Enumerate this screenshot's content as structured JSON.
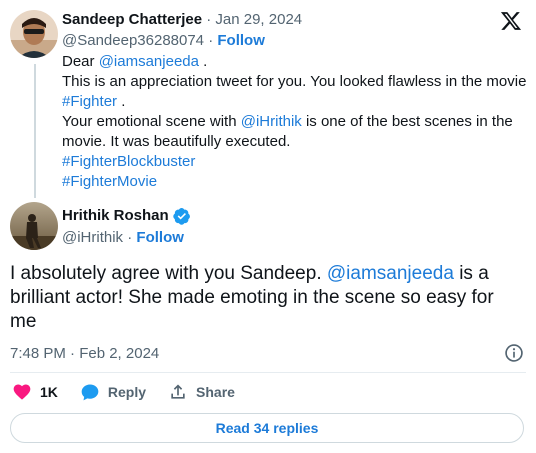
{
  "parent": {
    "name": "Sandeep Chatterjee",
    "separator": "·",
    "date": "Jan 29, 2024",
    "handle": "@Sandeep36288074",
    "follow_sep": "·",
    "follow": "Follow",
    "body": {
      "l1_a": "Dear ",
      "l1_mention": "@iamsanjeeda",
      "l1_b": " .",
      "l2": "This is an appreciation tweet for you. You looked flawless in the movie",
      "l3_tag": "#Fighter",
      "l3_b": " .",
      "l4_a": "Your emotional scene with ",
      "l4_mention": "@iHrithik",
      "l4_b": " is one of the best scenes in the",
      "l5": "movie. It was beautifully executed.",
      "l6_tag": "#FighterBlockbuster",
      "l7_tag": "#FighterMovie"
    }
  },
  "reply": {
    "name": "Hrithik Roshan",
    "verified_icon": "verified-badge-icon",
    "handle": "@iHrithik",
    "follow_sep": "·",
    "follow": "Follow",
    "text_a": "I absolutely agree with you Sandeep. ",
    "text_mention": "@iamsanjeeda",
    "text_b": " is a brilliant actor! She made emoting in the scene so easy for me",
    "timestamp": "7:48 PM · Feb 2, 2024"
  },
  "actions": {
    "likes": "1K",
    "reply": "Reply",
    "share": "Share"
  },
  "read_replies": "Read 34 replies",
  "colors": {
    "accent": "#1d7bd8",
    "like": "#f91880",
    "verified": "#1d9bf0"
  }
}
